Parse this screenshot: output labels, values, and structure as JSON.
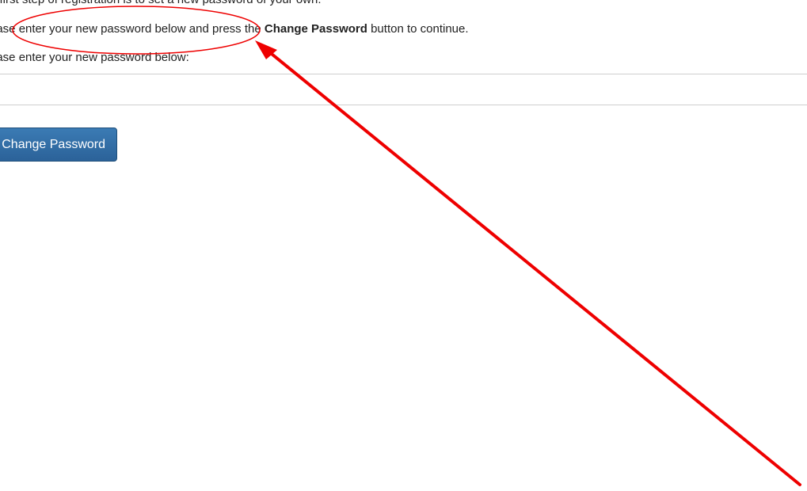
{
  "intro_text": "e first step of registration is to set a new password of your own.",
  "instruction": {
    "prefix": "ease enter your new password below and press the ",
    "strong": "Change Password",
    "suffix": " button to continue."
  },
  "password_prompt": "ease enter your new password below:",
  "password_field": {
    "value": "",
    "placeholder": ""
  },
  "change_password_button": "Change Password",
  "annotation": {
    "color": "#ee0000",
    "shapes": [
      "ellipse",
      "arrow"
    ]
  }
}
